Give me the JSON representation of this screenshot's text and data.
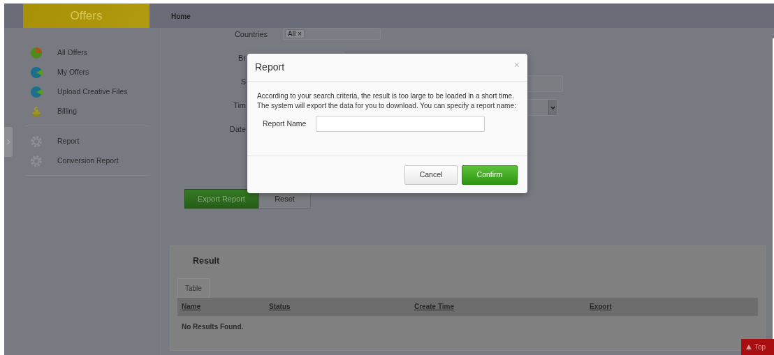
{
  "header": {
    "logo": "Offers",
    "nav": [
      "Home"
    ]
  },
  "sidebar": {
    "groups": [
      {
        "items": [
          {
            "label": "All Offers",
            "kind": "greenpie"
          },
          {
            "label": "My Offers",
            "kind": "bluepie"
          },
          {
            "label": "Upload Creative Files",
            "kind": "bluepie"
          },
          {
            "label": "Billing",
            "kind": "coins"
          }
        ]
      },
      {
        "items": [
          {
            "label": "Report",
            "kind": "gear"
          },
          {
            "label": "Conversion Report",
            "kind": "gear"
          }
        ]
      }
    ]
  },
  "filters": [
    {
      "label": "Countries",
      "kind": "tags",
      "tags": [
        {
          "label": "All",
          "remove": "×"
        }
      ]
    },
    {
      "label": "Br",
      "kind": "tags"
    },
    {
      "label": "S",
      "kind": "text"
    },
    {
      "label": "Tim",
      "kind": "select"
    },
    {
      "label": "Date",
      "kind": "none"
    }
  ],
  "actions": [
    "Export Report",
    "Reset"
  ],
  "result": {
    "title": "Result",
    "tabs": [
      {
        "label": "Table",
        "selected": true
      }
    ],
    "table": {
      "columns": [
        "Name",
        "Status",
        "Create Time",
        "Export"
      ],
      "empty_message": "No Results Found."
    }
  },
  "top_button": "Top",
  "modal": {
    "title": "Report",
    "close": "×",
    "message": [
      "According to your search criteria, the result is too large to be loaded in a short time.",
      "The system will export the data for you to download. You can specify a report name:"
    ],
    "field_label": "Report Name",
    "buttons": [
      {
        "label": "Cancel",
        "kind": "secondary"
      },
      {
        "label": "Confirm",
        "kind": "primary"
      }
    ]
  }
}
